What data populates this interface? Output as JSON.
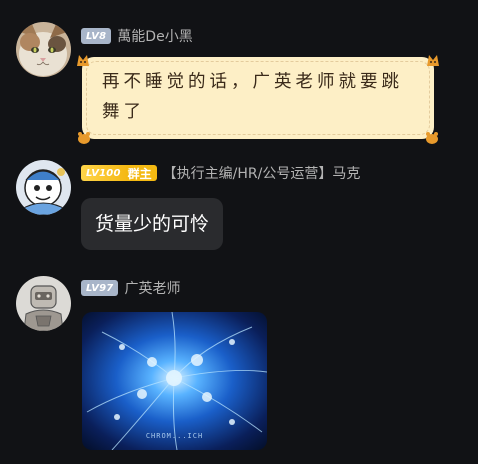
{
  "messages": [
    {
      "level_badge": "LV8",
      "nickname": "萬能De小黑",
      "bubble_style": "paper",
      "text": "再不睡觉的话，广英老师就要跳舞了",
      "text_line1": "再不睡觉的话，广英老师就要跳",
      "text_line2": "舞了"
    },
    {
      "level_badge": "LV100",
      "role_badge": "群主",
      "nickname": "【执行主编/HR/公号运营】马克",
      "bubble_style": "plain",
      "text": "货量少的可怜"
    },
    {
      "level_badge": "LV97",
      "nickname": "广英老师",
      "bubble_style": "image",
      "image_caption": "CHROM...ICH"
    }
  ],
  "colors": {
    "background": "#111215",
    "badge_gray": "#a8b5c9",
    "badge_gold": "#f4b912",
    "paper_bubble": "#fdefc6",
    "plain_bubble": "#2a2b2e"
  }
}
